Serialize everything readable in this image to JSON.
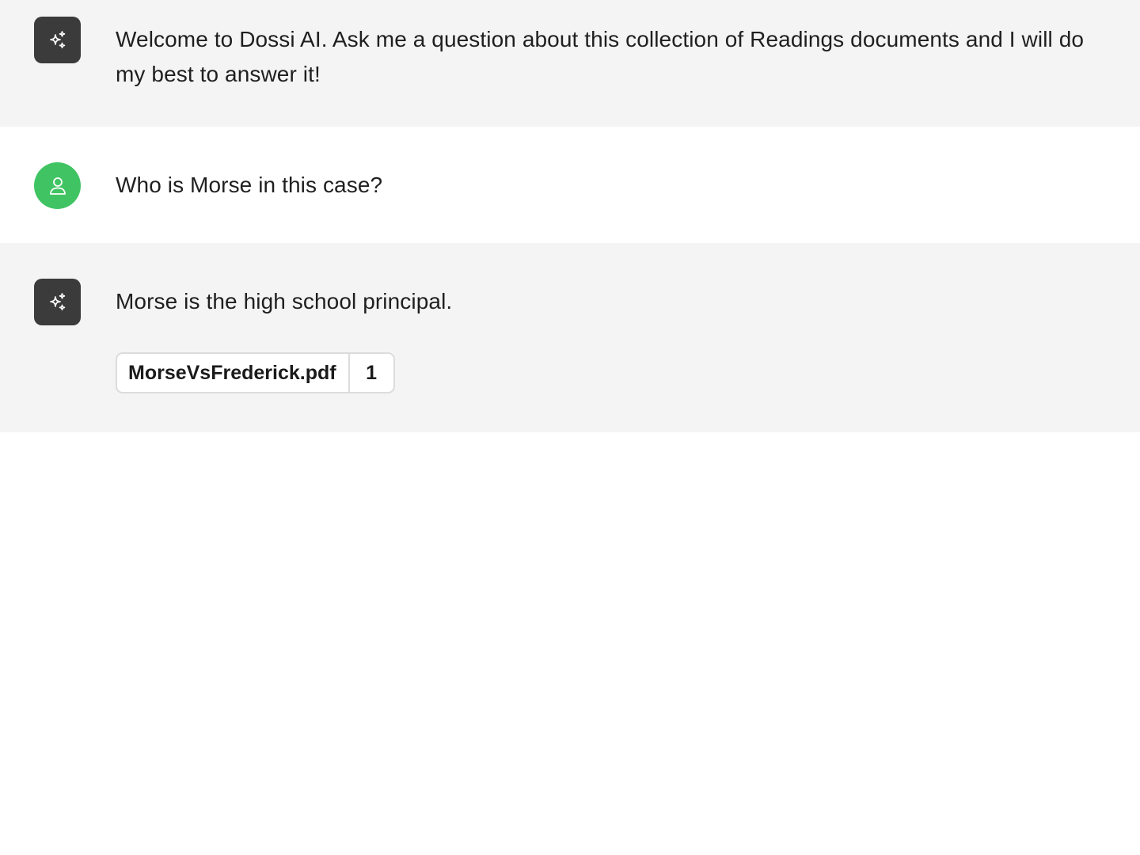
{
  "messages": [
    {
      "role": "assistant",
      "avatar_icon": "sparkles-icon",
      "text": "Welcome to Dossi AI. Ask me a question about this collection of Readings documents and I will do my best to answer it!"
    },
    {
      "role": "user",
      "avatar_icon": "user-icon",
      "text": "Who is Morse in this case?"
    },
    {
      "role": "assistant",
      "avatar_icon": "sparkles-icon",
      "text": "Morse is the high school principal.",
      "sources": [
        {
          "file": "MorseVsFrederick.pdf",
          "page": "1"
        }
      ]
    }
  ],
  "colors": {
    "assistant_bg": "#f4f4f4",
    "user_bg": "#ffffff",
    "ai_avatar": "#3b3b3b",
    "user_avatar": "#40c463"
  }
}
